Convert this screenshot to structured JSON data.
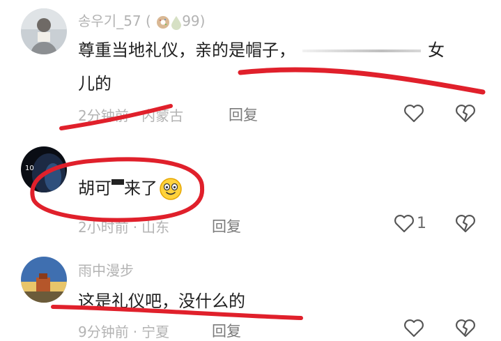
{
  "comments": [
    {
      "username": "송우기_57",
      "badge_count": "99",
      "line1_before": "尊重当地礼仪，亲的是帽子，",
      "line1_after": "女",
      "line2": "儿的",
      "time": "2分钟前",
      "location": "内蒙古",
      "reply_label": "回复",
      "like_count": ""
    },
    {
      "username": "",
      "avatar_text": "10",
      "text_a": "胡可",
      "text_b": "来了",
      "time": "2小时前",
      "location": "山东",
      "reply_label": "回复",
      "like_count": "1"
    },
    {
      "username": "雨中漫步",
      "text": "这是礼仪吧，没什么的",
      "time": "9分钟前",
      "location": "宁夏",
      "reply_label": "回复"
    }
  ],
  "colors": {
    "annotation": "#e0202b",
    "meta": "#b3b3b3",
    "text": "#1f1f1f"
  },
  "icons": [
    "heart-icon",
    "broken-heart-icon",
    "donut-badge-icon",
    "drop-badge-icon"
  ]
}
